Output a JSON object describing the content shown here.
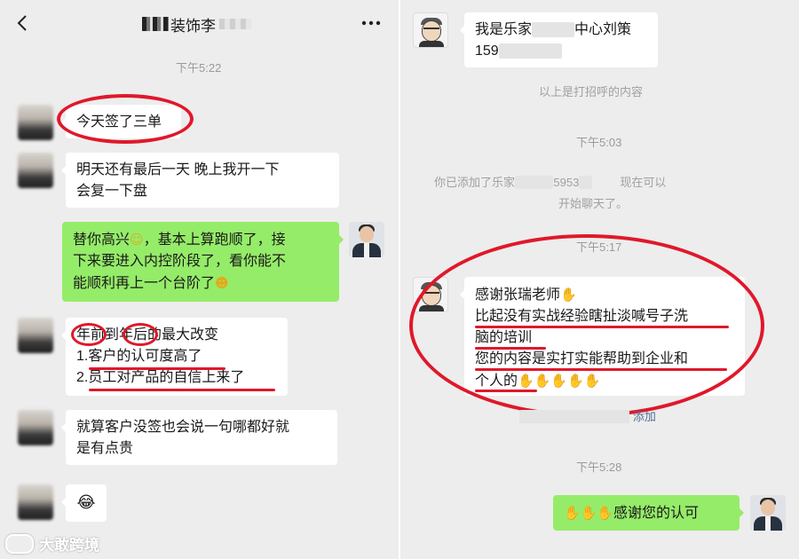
{
  "left": {
    "header": {
      "back_icon": "chevron-left-icon",
      "title_visible": "装饰李",
      "more_icon": "more-dots-icon"
    },
    "time_1": "下午5:22",
    "messages": [
      {
        "text": "今天签了三单"
      },
      {
        "line1": "明天还有最后一天  晚上我开一下",
        "line2": "会复一下盘"
      },
      {
        "line1": "替你高兴",
        "line1_rest": "，基本上算跑顺了，接",
        "line2": "下来要进入内控阶段了，看你能不",
        "line3": "能顺利再上一个台阶了"
      },
      {
        "line1": "年前到年后的最大改变",
        "line2": "1.客户的认可度高了",
        "line3": "2.员工对产品的自信上来了"
      },
      {
        "line1": "就算客户没签也会说一句哪都好就",
        "line2": "是有点贵"
      },
      {
        "emoji": "😂"
      }
    ],
    "watermark": "大敢跨境"
  },
  "right": {
    "top_card": {
      "line1_start": "我是乐家",
      "line1_end": "中心刘策",
      "line2": "159"
    },
    "system_1": "以上是打招呼的内容",
    "time_1": "下午5:03",
    "system_2_a": "你已添加了乐家",
    "system_2_b": "5953",
    "system_2_c": "现在可以",
    "system_2_line2": "开始聊天了。",
    "time_2": "下午5:17",
    "message": {
      "line1": "感谢张瑞老师",
      "line2": "比起没有实战经验瞎扯淡喊号子洗",
      "line3": "脑的培训",
      "line4": "您的内容是实打实能帮助到企业和",
      "line5": "个人的"
    },
    "hint_tail": "添加",
    "time_3": "下午5:28",
    "reply": "感谢您的认可"
  },
  "colors": {
    "annotation_red": "#e0182a",
    "bubble_green": "#95ec69",
    "chat_bg": "#ededed"
  }
}
